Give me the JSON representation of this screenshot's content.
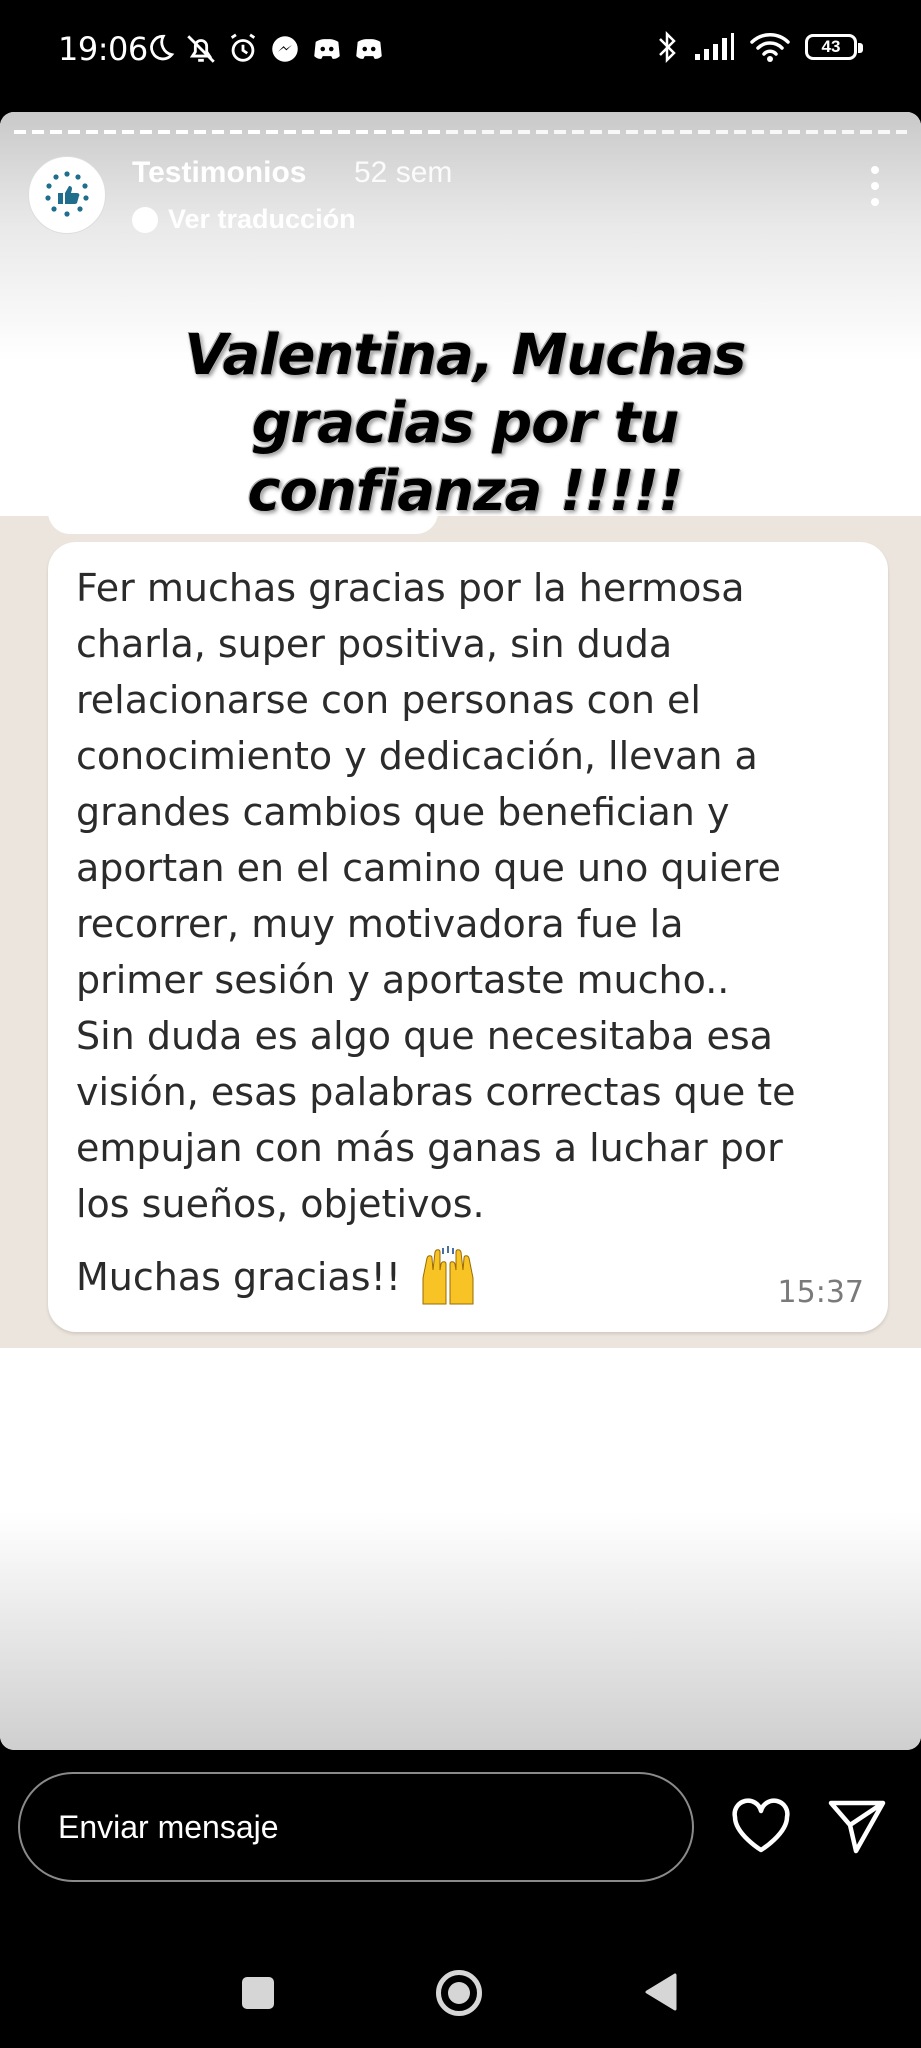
{
  "status_bar": {
    "time": "19:06",
    "battery": "43",
    "left_icons": [
      "moon-icon",
      "bell-off-icon",
      "alarm-icon",
      "messenger-icon",
      "discord-icon",
      "discord-icon"
    ],
    "right_icons": [
      "bluetooth-icon",
      "signal-icon",
      "wifi-icon",
      "battery-icon"
    ]
  },
  "story": {
    "progress": 0.48,
    "username": "Testimonios",
    "posted_ago": "52 sem",
    "translate_label": "Ver traducción",
    "headline": "Valentina, Muchas gracias por tu confianza !!!!!"
  },
  "message": {
    "body": "Fer muchas gracias por la hermosa\ncharla, super positiva, sin duda\nrelacionarse con personas con el\nconocimiento y dedicación, llevan a\ngrandes cambios que benefician y\naportan en el camino que uno quiere\nrecorrer, muy motivadora fue la\nprimer sesión y aportaste mucho..\nSin duda es algo que necesitaba esa\nvisión, esas palabras correctas que te\nempujan con más ganas a luchar por\nlos sueños, objetivos.",
    "closing": "Muchas gracias!!",
    "closing_emoji": "raised-hands-emoji",
    "time": "15:37"
  },
  "reply": {
    "placeholder": "Enviar mensaje"
  },
  "colors": {
    "chat_background": "#ece5dd",
    "bubble": "#ffffff",
    "avatar_accent": "#1f6e8c"
  }
}
